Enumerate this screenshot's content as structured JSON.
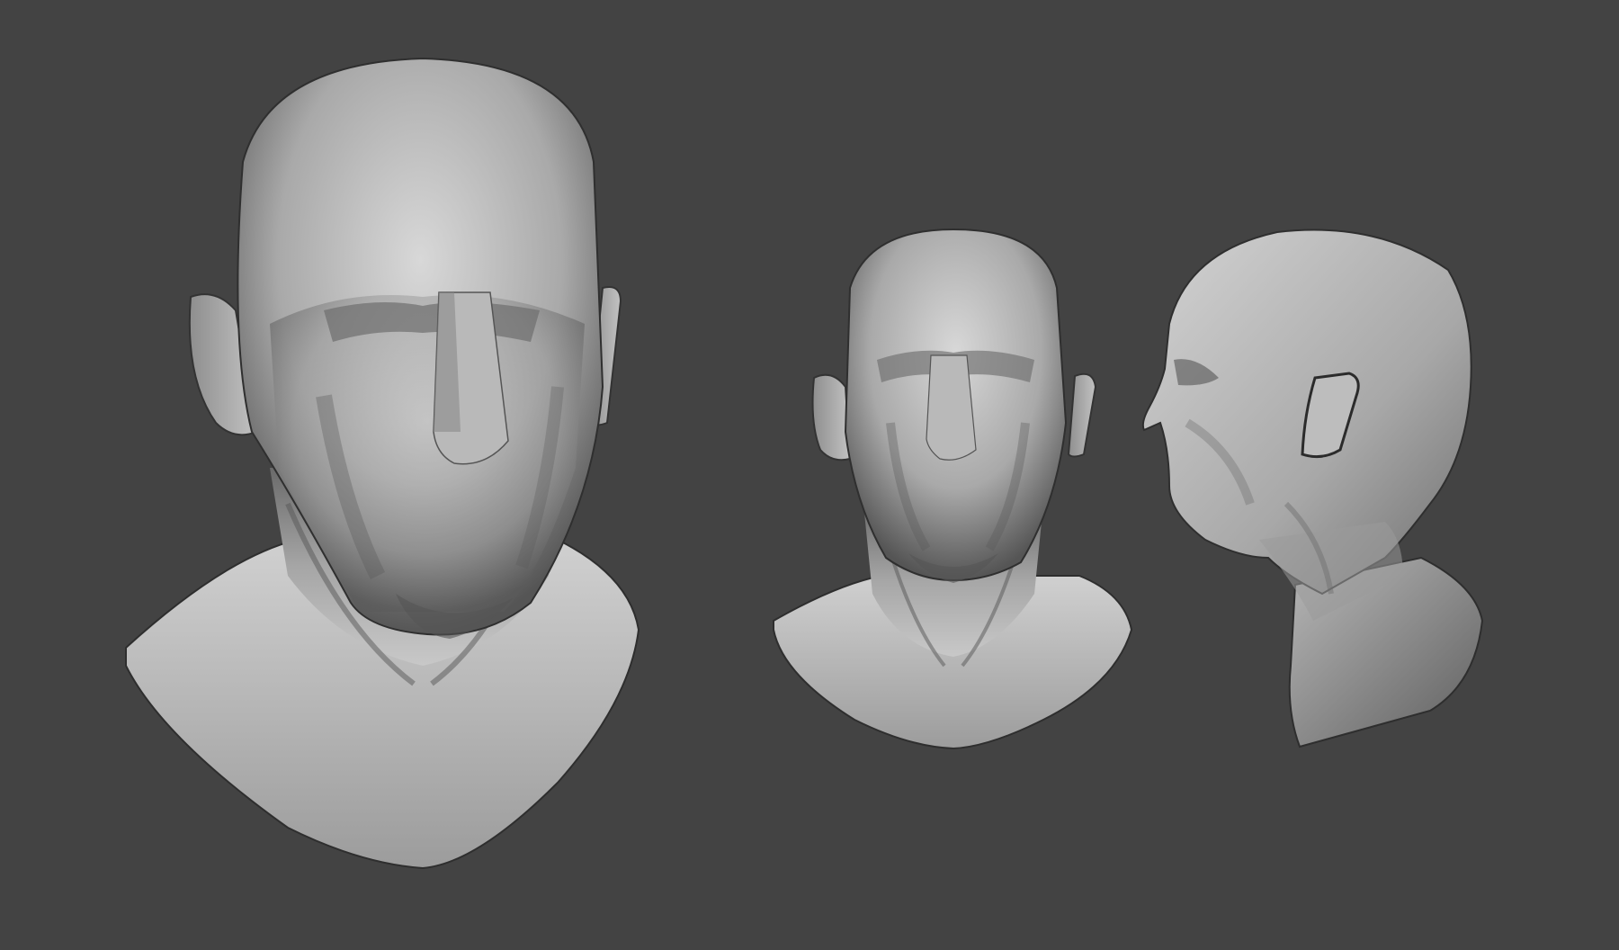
{
  "viewport": {
    "background": "#434343"
  },
  "models": [
    {
      "id": "head-front-large",
      "view": "front",
      "material_color": "#bdbdbd"
    },
    {
      "id": "head-front-small",
      "view": "front",
      "material_color": "#bdbdbd"
    },
    {
      "id": "head-side",
      "view": "three-quarter-side",
      "material_color": "#bdbdbd"
    }
  ]
}
